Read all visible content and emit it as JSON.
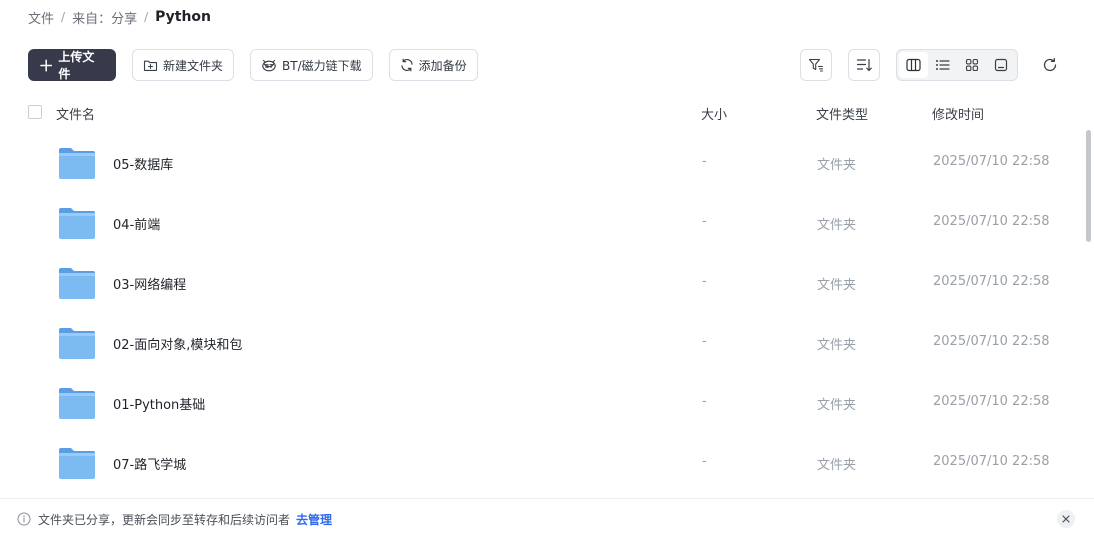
{
  "breadcrumb": {
    "root": "文件",
    "source": "来自：分享",
    "current": "Python"
  },
  "toolbar": {
    "upload_label": "上传文件",
    "new_folder_label": "新建文件夹",
    "bt_label": "BT/磁力链下载",
    "backup_label": "添加备份",
    "icons": {
      "upload": "plus-icon",
      "new_folder": "folder-plus-icon",
      "bt": "bt-icon",
      "backup": "sync-icon",
      "filter": "filter-icon",
      "sort": "sort-icon",
      "refresh": "refresh-icon"
    },
    "views": [
      "column-view-icon",
      "list-view-icon",
      "grid-view-icon",
      "preview-view-icon"
    ],
    "active_view": "column-view-icon"
  },
  "table": {
    "headers": {
      "name": "文件名",
      "size": "大小",
      "type": "文件类型",
      "modified": "修改时间"
    },
    "rows": [
      {
        "name": "05-数据库",
        "size": "-",
        "type": "文件夹",
        "modified": "2025/07/10 22:58"
      },
      {
        "name": "04-前端",
        "size": "-",
        "type": "文件夹",
        "modified": "2025/07/10 22:58"
      },
      {
        "name": "03-网络编程",
        "size": "-",
        "type": "文件夹",
        "modified": "2025/07/10 22:58"
      },
      {
        "name": "02-面向对象,模块和包",
        "size": "-",
        "type": "文件夹",
        "modified": "2025/07/10 22:58"
      },
      {
        "name": "01-Python基础",
        "size": "-",
        "type": "文件夹",
        "modified": "2025/07/10 22:58"
      },
      {
        "name": "07-路飞学城",
        "size": "-",
        "type": "文件夹",
        "modified": "2025/07/10 22:58"
      }
    ]
  },
  "notice": {
    "message": "文件夹已分享，更新会同步至转存和后续访问者",
    "action_label": "去管理"
  },
  "colors": {
    "primary_button": "#363a4b",
    "link": "#2e6bf0",
    "folder": "#6fb3f0"
  }
}
